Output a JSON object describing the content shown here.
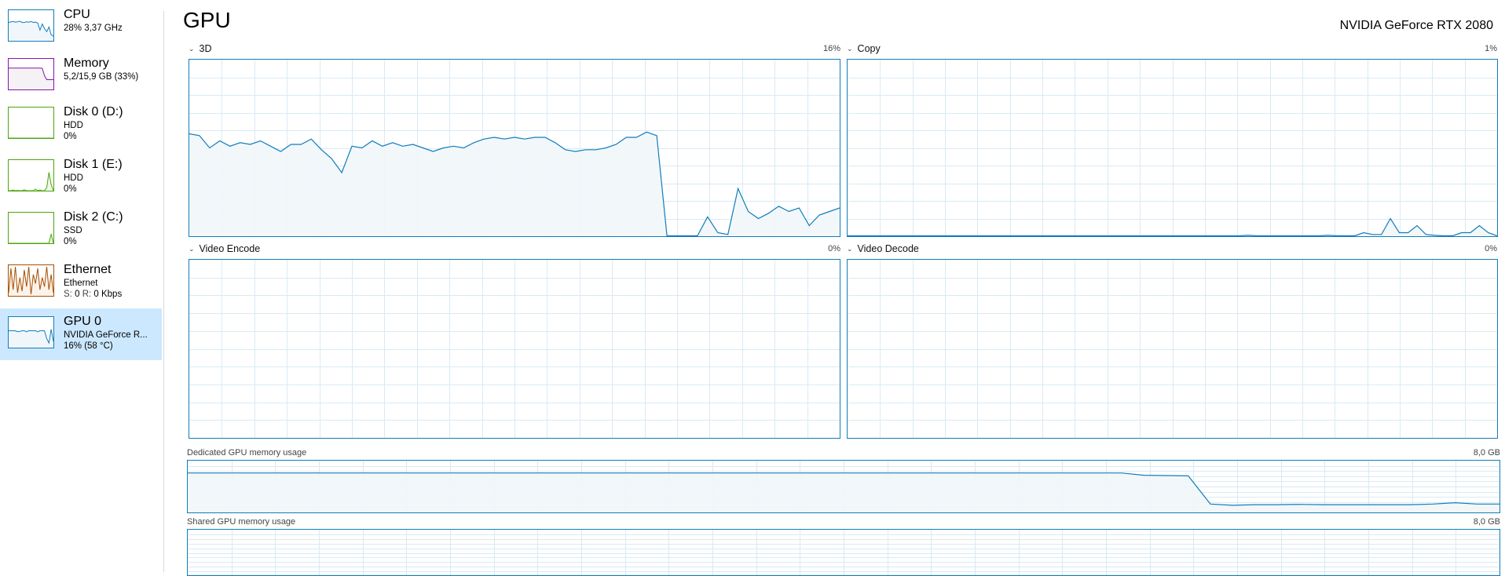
{
  "sidebar": {
    "items": [
      {
        "title": "CPU",
        "line1": "28%  3,37 GHz",
        "line2": "",
        "color": "#117dbb",
        "fill": "#f1f6fa"
      },
      {
        "title": "Memory",
        "line1": "5,2/15,9 GB (33%)",
        "line2": "",
        "color": "#8b12ae",
        "fill": "#f4f2f4"
      },
      {
        "title": "Disk 0 (D:)",
        "line1": "HDD",
        "line2": "0%",
        "color": "#4da60c",
        "fill": "#eff7ec"
      },
      {
        "title": "Disk 1 (E:)",
        "line1": "HDD",
        "line2": "0%",
        "color": "#4da60c",
        "fill": "#eff7ec"
      },
      {
        "title": "Disk 2 (C:)",
        "line1": "SSD",
        "line2": "0%",
        "color": "#4da60c",
        "fill": "#eff7ec"
      },
      {
        "title": "Ethernet",
        "line1": "Ethernet",
        "line2_s_label": "S:",
        "line2_s": "0",
        "line2_r_label": "R:",
        "line2_r": "0 Kbps",
        "color": "#a74f01",
        "fill": "#fcf3eb"
      },
      {
        "title": "GPU 0",
        "line1": "NVIDIA GeForce R...",
        "line2": "16%  (58 °C)",
        "color": "#117dbb",
        "fill": "#f1f6fa",
        "selected": true
      }
    ]
  },
  "header": {
    "title": "GPU",
    "gpu_name": "NVIDIA GeForce RTX 2080"
  },
  "engines": [
    {
      "label": "3D",
      "max": "16%"
    },
    {
      "label": "Copy",
      "max": "1%"
    },
    {
      "label": "Video Encode",
      "max": "0%"
    },
    {
      "label": "Video Decode",
      "max": "0%"
    }
  ],
  "memory": {
    "dedicated": {
      "label": "Dedicated GPU memory usage",
      "max": "8,0 GB"
    },
    "shared": {
      "label": "Shared GPU memory usage",
      "max": "8,0 GB"
    }
  },
  "colors": {
    "accent": "#117dbb",
    "grid": "#d9eaf4",
    "fill": "#f1f6fa",
    "selected": "#cce8ff"
  },
  "chart_data": [
    {
      "type": "area",
      "title": "3D",
      "ylim": [
        0,
        100
      ],
      "grid": true,
      "values": [
        58,
        57,
        50,
        54,
        51,
        53,
        52,
        54,
        51,
        48,
        52,
        52,
        55,
        49,
        44,
        36,
        51,
        50,
        54,
        51,
        53,
        51,
        52,
        50,
        48,
        50,
        51,
        50,
        53,
        55,
        56,
        55,
        56,
        55,
        56,
        56,
        53,
        49,
        48,
        49,
        49,
        50,
        52,
        56,
        56,
        59,
        57,
        0,
        0,
        0,
        0,
        11,
        2,
        1,
        27,
        14,
        10,
        13,
        17,
        14,
        16,
        6,
        12,
        14,
        16
      ]
    },
    {
      "type": "area",
      "title": "Copy",
      "ylim": [
        0,
        100
      ],
      "grid": true,
      "values": [
        0,
        0,
        0,
        0,
        0,
        0,
        0,
        0,
        0,
        0,
        0,
        0,
        0,
        0,
        0,
        0,
        0,
        0,
        0,
        0,
        0,
        0,
        0,
        0,
        0,
        0,
        0,
        0,
        0,
        0,
        0,
        0,
        0,
        0,
        0,
        0,
        0,
        0,
        0,
        0,
        0,
        0,
        0,
        0,
        0,
        0.5,
        0,
        0,
        0,
        0,
        0,
        0,
        0,
        0,
        0.5,
        0,
        0,
        0,
        2,
        1,
        1,
        10,
        2,
        2,
        6,
        1,
        0.5,
        0,
        0,
        2,
        2,
        6,
        2,
        0
      ]
    },
    {
      "type": "area",
      "title": "Video Encode",
      "ylim": [
        0,
        100
      ],
      "grid": true,
      "values": []
    },
    {
      "type": "area",
      "title": "Video Decode",
      "ylim": [
        0,
        100
      ],
      "grid": true,
      "values": []
    },
    {
      "type": "area",
      "title": "Dedicated GPU memory usage",
      "ylim": [
        0,
        8
      ],
      "grid": true,
      "values": [
        6.1,
        6.1,
        6.1,
        6.1,
        6.1,
        6.1,
        6.1,
        6.1,
        6.1,
        6.1,
        6.1,
        6.1,
        6.1,
        6.1,
        6.1,
        6.1,
        6.1,
        6.1,
        6.1,
        6.1,
        6.1,
        6.1,
        6.1,
        6.1,
        6.1,
        6.1,
        6.1,
        6.1,
        6.1,
        6.1,
        6.1,
        6.1,
        6.1,
        6.1,
        6.1,
        6.1,
        6.1,
        6.1,
        6.1,
        6.1,
        6.1,
        6.1,
        6.1,
        5.75,
        5.7,
        5.65,
        1.3,
        1.1,
        1.2,
        1.2,
        1.25,
        1.2,
        1.2,
        1.2,
        1.2,
        1.2,
        1.3,
        1.5,
        1.3,
        1.3
      ]
    },
    {
      "type": "area",
      "title": "Shared GPU memory usage",
      "ylim": [
        0,
        8
      ],
      "grid": true,
      "values": [
        0,
        0,
        0,
        0,
        0,
        0,
        0,
        0,
        0,
        0,
        0,
        0,
        0,
        0,
        0,
        0,
        0,
        0,
        0,
        0,
        0,
        0,
        0,
        0,
        0,
        0,
        0,
        0,
        0,
        0,
        0,
        0,
        0,
        0,
        0,
        0,
        0,
        0,
        0,
        0,
        0,
        0,
        0,
        0,
        0,
        0,
        0,
        0,
        0,
        0,
        0,
        0,
        0,
        0,
        0,
        0,
        0,
        0,
        0,
        0
      ]
    }
  ],
  "sidebar_sparklines": [
    [
      60,
      62,
      63,
      61,
      62,
      64,
      60,
      60,
      62,
      61,
      63,
      60,
      61,
      58,
      35,
      55,
      40,
      30,
      45,
      20,
      15
    ],
    [
      70,
      70,
      70,
      70,
      70,
      70,
      70,
      70,
      70,
      70,
      70,
      70,
      70,
      70,
      70,
      69,
      45,
      32,
      32,
      32,
      32
    ],
    [
      0,
      0,
      0,
      0,
      0,
      0,
      0,
      0,
      0,
      0,
      0,
      0,
      0,
      0,
      0,
      0,
      0,
      0,
      0,
      0,
      0
    ],
    [
      0,
      0,
      2,
      0,
      1,
      0,
      0,
      3,
      0,
      0,
      0,
      0,
      5,
      0,
      2,
      0,
      0,
      10,
      60,
      20,
      0
    ],
    [
      0,
      0,
      0,
      0,
      0,
      0,
      0,
      0,
      0,
      0,
      0,
      0,
      0,
      0,
      0,
      0,
      0,
      0,
      0,
      30,
      0
    ],
    [
      10,
      90,
      20,
      95,
      10,
      60,
      15,
      85,
      30,
      95,
      5,
      70,
      40,
      90,
      20,
      60,
      30,
      95,
      20,
      70,
      10
    ],
    [
      55,
      55,
      55,
      55,
      52,
      53,
      55,
      55,
      52,
      55,
      55,
      55,
      55,
      52,
      55,
      55,
      55,
      30,
      15,
      60,
      20
    ]
  ]
}
